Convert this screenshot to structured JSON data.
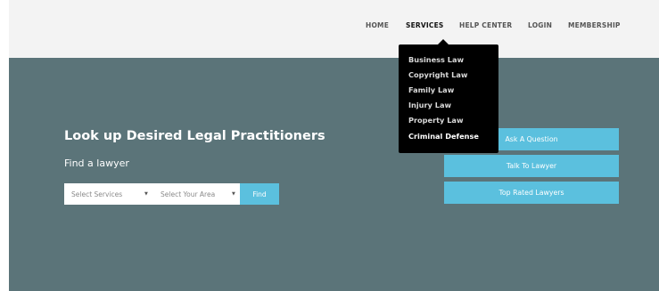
{
  "nav": {
    "items": [
      {
        "label": "HOME"
      },
      {
        "label": "SERVICES"
      },
      {
        "label": "HELP CENTER"
      },
      {
        "label": "LOGIN"
      },
      {
        "label": "MEMBERSHIP"
      }
    ],
    "active": "SERVICES"
  },
  "services_menu": {
    "items": [
      {
        "label": "Business Law"
      },
      {
        "label": "Copyright Law"
      },
      {
        "label": "Family Law"
      },
      {
        "label": "Injury Law"
      },
      {
        "label": "Property Law"
      },
      {
        "label": "Criminal Defense"
      }
    ],
    "highlighted": "Criminal Defense"
  },
  "hero": {
    "title": "Look up Desired Legal Practitioners",
    "subtitle": "Find a lawyer"
  },
  "search": {
    "services_select": "Select Services",
    "area_select": "Select Your Area",
    "find_label": "Find"
  },
  "actions": {
    "ask": "Ask A Question",
    "talk": "Talk To Lawyer",
    "top_rated": "Top Rated Lawyers"
  },
  "colors": {
    "header_bg": "#f3f3f3",
    "hero_bg": "#5b7479",
    "accent": "#5bc0de",
    "dropdown_bg": "#000000"
  },
  "icons": {
    "select_caret": "caret-down-icon"
  }
}
